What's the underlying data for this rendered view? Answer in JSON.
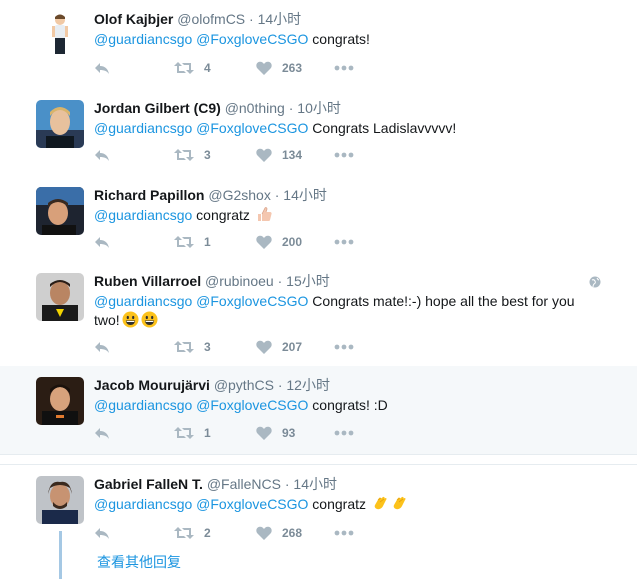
{
  "tweets": [
    {
      "name": "Olof Kajbjer",
      "handle": "@olofmCS",
      "sep": "·",
      "time": "14小时",
      "mention1": "@guardiancsgo",
      "mention2": "@FoxgloveCSGO",
      "text": " congrats!",
      "retweets": "4",
      "likes": "263"
    },
    {
      "name": "Jordan Gilbert (C9)",
      "handle": "@n0thing",
      "sep": "·",
      "time": "10小时",
      "mention1": "@guardiancsgo",
      "mention2": "@FoxgloveCSGO",
      "text": " Congrats Ladislavvvvv!",
      "retweets": "3",
      "likes": "134"
    },
    {
      "name": "Richard Papillon",
      "handle": "@G2shox",
      "sep": "·",
      "time": "14小时",
      "mention1": "@guardiancsgo",
      "text": " congratz ",
      "emoji": "thumbs-up-emoji",
      "retweets": "1",
      "likes": "200"
    },
    {
      "name": "Ruben Villarroel",
      "handle": "@rubinoeu",
      "sep": "·",
      "time": "15小时",
      "mention1": "@guardiancsgo",
      "mention2": "@FoxgloveCSGO",
      "text": " Congrats mate!:-) hope all the best for you two!",
      "emoji": "grinning-face-emoji",
      "retweets": "3",
      "likes": "207"
    },
    {
      "name": "Jacob Mourujärvi",
      "handle": "@pythCS",
      "sep": "·",
      "time": "12小时",
      "mention1": "@guardiancsgo",
      "mention2": "@FoxgloveCSGO",
      "text": " congrats! :D",
      "retweets": "1",
      "likes": "93"
    },
    {
      "name": "Gabriel FalleN T.",
      "handle": "@FalleNCS",
      "sep": "·",
      "time": "14小时",
      "mention1": "@guardiancsgo",
      "mention2": "@FoxgloveCSGO",
      "text": " congratz ",
      "emoji": "clapping-hands-emoji",
      "retweets": "2",
      "likes": "268"
    }
  ],
  "more_replies": "查看其他回复",
  "colors": {
    "link": "#1b95e0",
    "icon": "#aab8c2",
    "hover_bg": "#f5f8fa",
    "border": "#e6ecf0"
  }
}
